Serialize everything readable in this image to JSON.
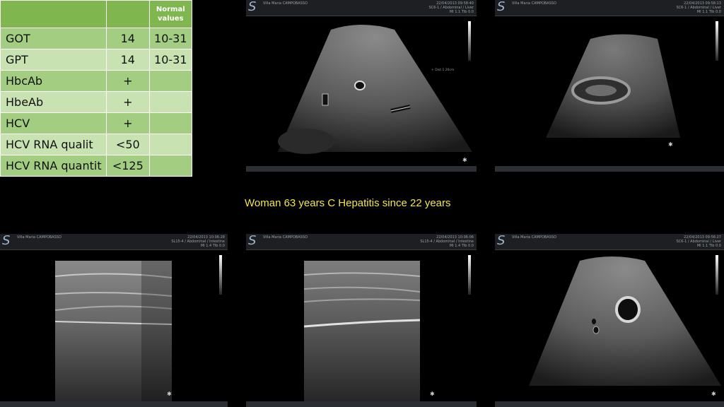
{
  "lab_table": {
    "header": {
      "normal_values": "Normal values"
    },
    "rows": [
      {
        "test": "GOT",
        "value": "14",
        "normal": "10-31"
      },
      {
        "test": "GPT",
        "value": "14",
        "normal": "10-31"
      },
      {
        "test": "HbcAb",
        "value": "+",
        "normal": ""
      },
      {
        "test": "HbeAb",
        "value": "+",
        "normal": ""
      },
      {
        "test": "HCV",
        "value": "+",
        "normal": ""
      },
      {
        "test": "HCV RNA qualit",
        "value": "<50",
        "normal": ""
      },
      {
        "test": "HCV RNA quantit",
        "value": "<125",
        "normal": ""
      }
    ]
  },
  "caption": "Woman 63 years C Hepatitis since 22 years",
  "ultrasound_images": [
    {
      "facility": "Villa Maria CAMPOBASSO",
      "datetime": "22/04/2013 09:58:40",
      "probe": "SC6-1 / Abdominal / Liver",
      "settings": "MI 1.1 TIb 0.0",
      "measure": "+ Dist 1.26cm"
    },
    {
      "facility": "Villa Maria CAMPOBASSO",
      "datetime": "22/04/2013 09:58:13",
      "probe": "SC6-1 / Abdominal / Liver",
      "settings": "MI 1.1 TIb 0.0",
      "measure": ""
    },
    {
      "facility": "Villa Maria CAMPOBASSO",
      "datetime": "22/04/2013 10:06:28",
      "probe": "SL15-4 / Abdominal / Intestine",
      "settings": "MI 1.4 TIb 0.0",
      "measure": ""
    },
    {
      "facility": "Villa Maria CAMPOBASSO",
      "datetime": "22/04/2013 10:06:06",
      "probe": "SL15-4 / Abdominal / Intestine",
      "settings": "MI 1.4 TIb 0.0",
      "measure": ""
    },
    {
      "facility": "Villa Maria CAMPOBASSO",
      "datetime": "22/04/2013 09:56:27",
      "probe": "SC6-1 / Abdominal / Liver",
      "settings": "MI 1.1 TIb 0.0",
      "measure": ""
    }
  ],
  "colors": {
    "table_header": "#7fb64e",
    "row_dark": "#a3cd80",
    "row_light": "#c8e3b1",
    "caption": "#f2e64a"
  }
}
